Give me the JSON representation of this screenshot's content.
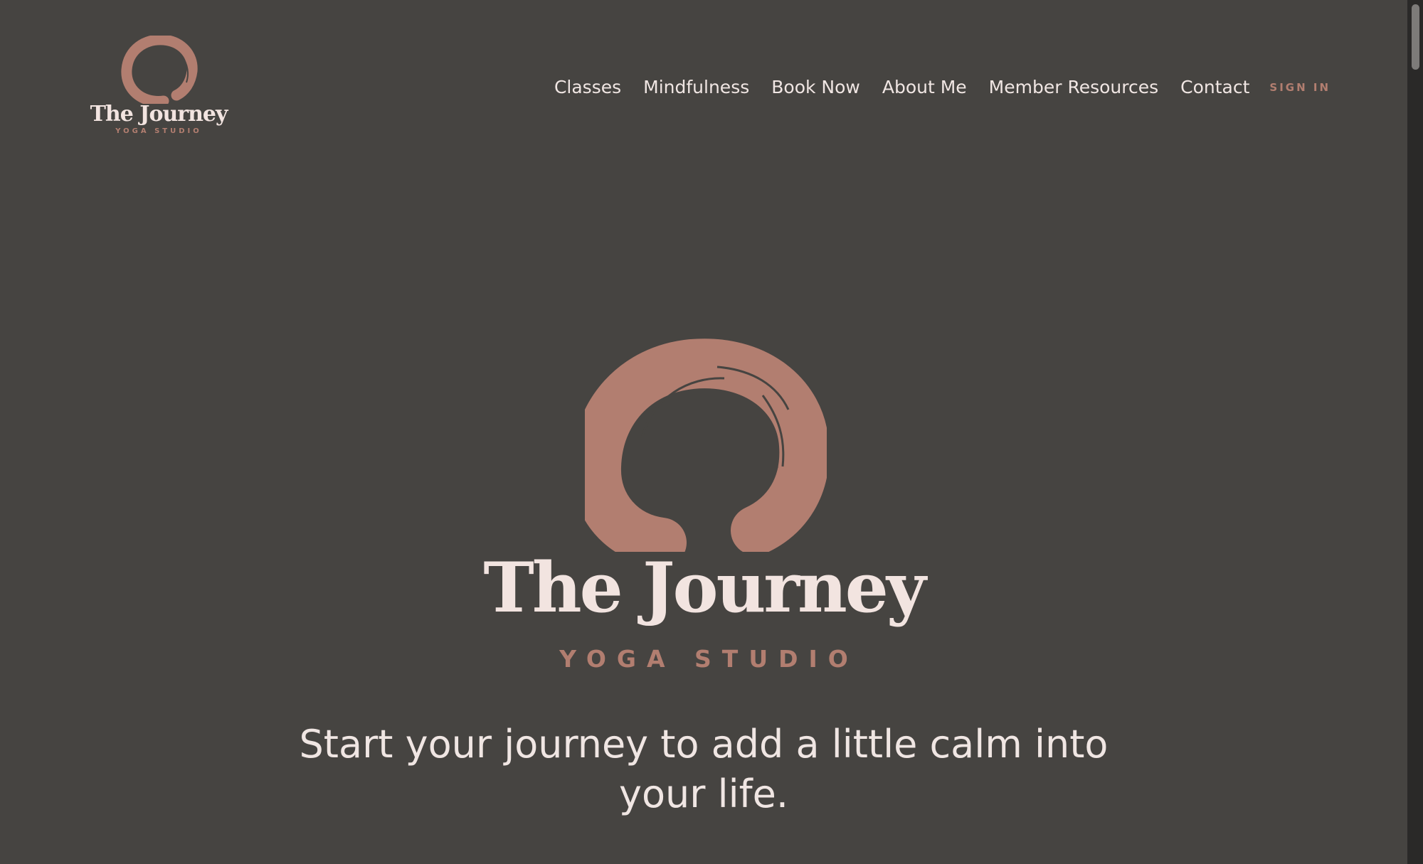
{
  "colors": {
    "background": "#464441",
    "accent": "#b27e70",
    "text": "#f0e6e3"
  },
  "header": {
    "logo": {
      "title": "The Journey",
      "subtitle": "YOGA STUDIO",
      "icon": "enso-circle-icon"
    },
    "nav": [
      {
        "label": "Classes"
      },
      {
        "label": "Mindfulness"
      },
      {
        "label": "Book Now"
      },
      {
        "label": "About Me"
      },
      {
        "label": "Member Resources"
      },
      {
        "label": "Contact"
      }
    ],
    "sign_in_label": "SIGN IN"
  },
  "hero": {
    "icon": "enso-circle-icon",
    "title": "The Journey",
    "subtitle": "YOGA STUDIO",
    "tagline": "Start your journey to add a little calm into your life."
  }
}
